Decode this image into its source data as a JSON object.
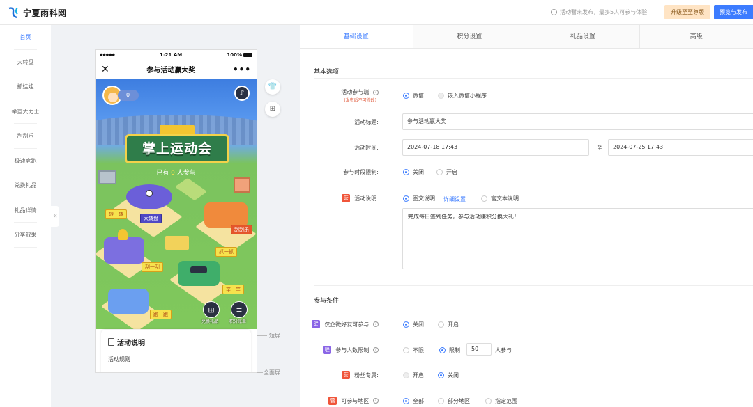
{
  "brand": {
    "name": "宁夏雨科网"
  },
  "topbar": {
    "notice": "活动暂未发布，最多5人可参与体验",
    "upgrade_label": "升级至至尊版",
    "publish_label": "预览与发布"
  },
  "sidenav": {
    "items": [
      {
        "label": "首页",
        "active": true
      },
      {
        "label": "大转盘"
      },
      {
        "label": "抓娃娃"
      },
      {
        "label": "举重大力士"
      },
      {
        "label": "刮刮乐"
      },
      {
        "label": "极速竞跑"
      },
      {
        "label": "兑换礼品"
      },
      {
        "label": "礼品详情"
      },
      {
        "label": "分享效果"
      }
    ],
    "collapse_glyph": "«"
  },
  "phone": {
    "status_time": "1:21 AM",
    "status_signal": "●●●●●",
    "status_battery": "100%",
    "title": "参与活动赢大奖",
    "close_glyph": "✕",
    "more_glyph": "•••",
    "score": "0",
    "music_glyph": "♪",
    "game_title": "掌上运动会",
    "joined_prefix": "已有",
    "joined_count": "0",
    "joined_suffix": "人参与",
    "tags": {
      "dazhuanpan": "大转盘",
      "yizhuan": "转一转",
      "zhuayizhua": "抓一抓",
      "guayigua": "刮一刮",
      "juyiju": "举一举",
      "paoyipao": "跑一跑",
      "guaguale": "刮刮乐"
    },
    "actions": {
      "exchange_label": "兑换礼品",
      "points_label": "积分账单"
    },
    "desc_title": "活动说明",
    "desc_sub": "活动规则"
  },
  "preview_markers": {
    "short_screen": "短屏",
    "full_screen": "全面屏"
  },
  "tabs": [
    {
      "label": "基础设置",
      "active": true
    },
    {
      "label": "积分设置"
    },
    {
      "label": "礼品设置"
    },
    {
      "label": "高级"
    }
  ],
  "basic": {
    "section_title": "基本选项",
    "platform": {
      "label": "活动参与端:",
      "sub": "(发布后不可修改)",
      "options": [
        "微信",
        "嵌入微信小程序"
      ]
    },
    "title_field": {
      "label": "活动标题:",
      "value": "参与活动赢大奖"
    },
    "time_field": {
      "label": "活动时间:",
      "start": "2024-07-18 17:43",
      "separator": "至",
      "end": "2024-07-25 17:43"
    },
    "time_limit": {
      "label": "参与时段限制:",
      "options": [
        "关闭",
        "开启"
      ]
    },
    "description": {
      "badge": "营",
      "label": "活动说明:",
      "options": [
        "图文说明",
        "富文本说明"
      ],
      "detail_link": "详细设置",
      "text": "完成每日签到任务，参与活动赚积分换大礼！"
    }
  },
  "conditions": {
    "section_title": "参与条件",
    "wecom_friends": {
      "badge": "联",
      "label": "仅企微好友可参与:",
      "options": [
        "关闭",
        "开启"
      ]
    },
    "people_limit": {
      "badge": "联",
      "label": "参与人数限制:",
      "options": [
        "不限",
        "限制"
      ],
      "value": "50",
      "suffix": "人参与"
    },
    "fans_only": {
      "badge": "营",
      "label": "粉丝专属:",
      "options": [
        "开启",
        "关闭"
      ]
    },
    "region": {
      "badge": "营",
      "label": "可参与地区:",
      "options": [
        "全部",
        "部分地区",
        "指定范围"
      ]
    }
  },
  "colors": {
    "accent": "#3c7cff",
    "upgrade_bg": "#ffe4c4",
    "badge_red": "#f0553a",
    "badge_purple": "#8a65e6"
  }
}
